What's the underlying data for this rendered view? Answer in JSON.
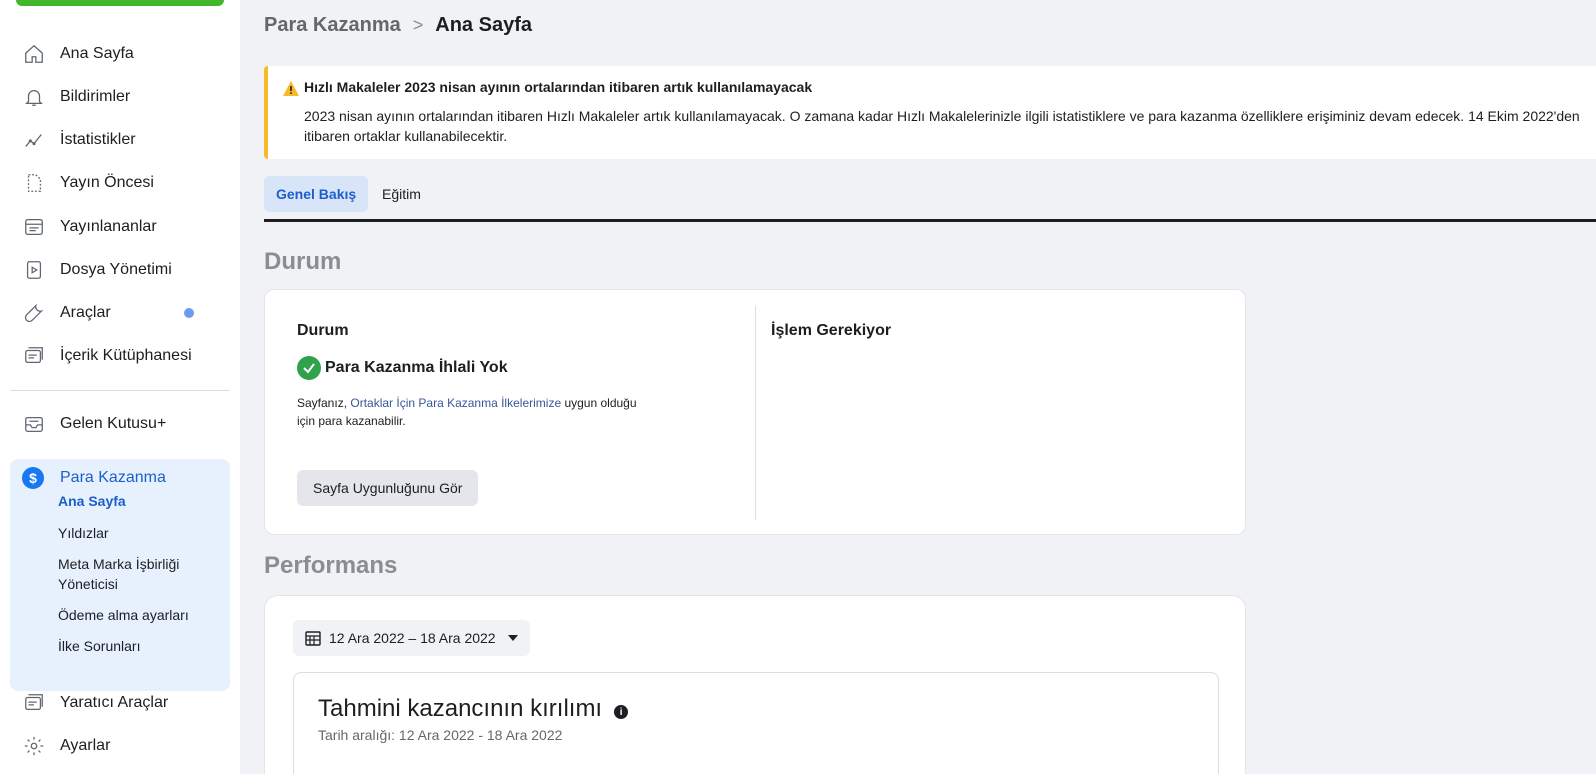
{
  "sidebar": {
    "items": [
      {
        "label": "Ana Sayfa",
        "icon": "home-icon"
      },
      {
        "label": "Bildirimler",
        "icon": "bell-icon"
      },
      {
        "label": "İstatistikler",
        "icon": "chart-line-icon"
      },
      {
        "label": "Yayın Öncesi",
        "icon": "draft-file-icon"
      },
      {
        "label": "Yayınlananlar",
        "icon": "published-list-icon"
      },
      {
        "label": "Dosya Yönetimi",
        "icon": "video-file-icon"
      },
      {
        "label": "Araçlar",
        "icon": "wrench-icon"
      },
      {
        "label": "İçerik Kütüphanesi",
        "icon": "library-icon"
      },
      {
        "label": "Gelen Kutusu+",
        "icon": "inbox-icon"
      },
      {
        "label": "Yaratıcı Araçlar",
        "icon": "creator-tools-icon"
      },
      {
        "label": "Ayarlar",
        "icon": "gear-icon"
      }
    ],
    "monetization": {
      "label": "Para Kazanma",
      "icon": "dollar-icon",
      "sub_items": [
        "Ana Sayfa",
        "Yıldızlar",
        "Meta Marka İşbirliği Yöneticisi",
        "Ödeme alma ayarları",
        "İlke Sorunları"
      ]
    }
  },
  "breadcrumb": {
    "parent": "Para Kazanma",
    "separator": ">",
    "current": "Ana Sayfa"
  },
  "alert": {
    "title": "Hızlı Makaleler 2023 nisan ayının ortalarından itibaren artık kullanılamayacak",
    "body": "2023 nisan ayının ortalarından itibaren Hızlı Makaleler artık kullanılamayacak. O zamana kadar Hızlı Makalelerinizle ilgili istatistiklere ve para kazanma özelliklere erişiminiz devam edecek. 14 Ekim 2022'den itibaren ortaklar kullanabilecektir."
  },
  "tabs": [
    {
      "label": "Genel Bakış",
      "active": true
    },
    {
      "label": "Eğitim",
      "active": false
    }
  ],
  "status_section": {
    "title": "Durum",
    "left_title": "Durum",
    "status_label": "Para Kazanma İhlali Yok",
    "desc_prefix": "Sayfanız, ",
    "desc_link": "Ortaklar İçin Para Kazanma İlkelerimize",
    "desc_suffix": " uygun olduğu için para kazanabilir.",
    "button_label": "Sayfa Uygunluğunu Gör",
    "right_title": "İşlem Gerekiyor"
  },
  "performance_section": {
    "title": "Performans",
    "date_range": "12 Ara 2022 – 18 Ara 2022",
    "earnings_title": "Tahmini kazancının kırılımı",
    "earnings_range": "Tarih aralığı: 12 Ara 2022 - 18 Ara 2022"
  },
  "colors": {
    "accent": "#1b5fcc",
    "warning": "#f7b928",
    "success": "#31a24c",
    "brand_green": "#42b72a"
  }
}
